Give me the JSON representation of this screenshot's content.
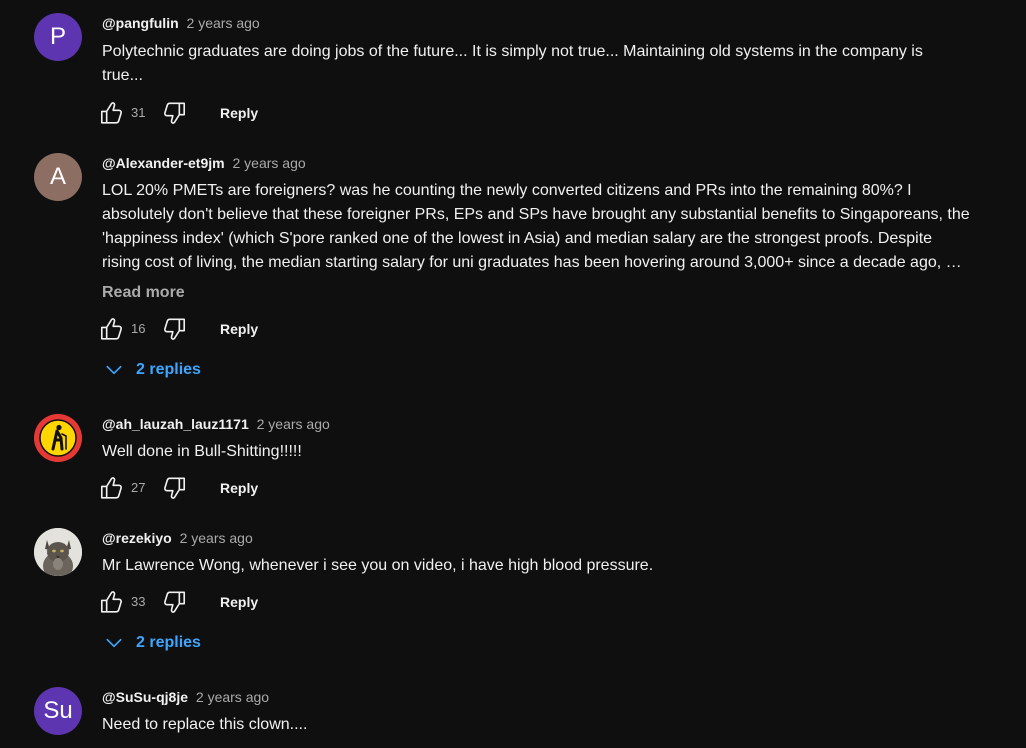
{
  "comments": [
    {
      "author": "@pangfulin",
      "time": "2 years ago",
      "avatar_letter": "P",
      "avatar_color": "#5e35b1",
      "text_lines": [
        "Polytechnic graduates are doing jobs of the future... It is simply not true... Maintaining old systems in the company is",
        "true..."
      ],
      "likes": "31",
      "reply_label": "Reply"
    },
    {
      "author": "@Alexander-et9jm",
      "time": "2 years ago",
      "avatar_letter": "A",
      "avatar_color": "#8d6e63",
      "text_lines": [
        "LOL 20% PMETs are foreigners? was he counting the newly converted citizens and PRs into the remaining 80%? I",
        "absolutely don't believe that these foreigner PRs, EPs and SPs have brought any substantial benefits to Singaporeans, the",
        "'happiness index' (which S'pore ranked one of the lowest in Asia) and median salary are the strongest proofs. Despite",
        "rising cost of living, the median starting salary for uni graduates has been hovering around 3,000+ since a decade ago, …"
      ],
      "read_more": "Read more",
      "likes": "16",
      "reply_label": "Reply",
      "replies_label": "2 replies"
    },
    {
      "author": "@ah_lauzah_lauz1171",
      "time": "2 years ago",
      "avatar_icon": "elderly-person-warning-sign-icon",
      "text_lines": [
        "Well done in Bull-Shitting!!!!!"
      ],
      "likes": "27",
      "reply_label": "Reply"
    },
    {
      "author": "@rezekiyo",
      "time": "2 years ago",
      "avatar_icon": "cat-photo-icon",
      "text_lines": [
        "Mr Lawrence Wong, whenever i see you on video, i have high blood pressure."
      ],
      "likes": "33",
      "reply_label": "Reply",
      "replies_label": "2 replies"
    },
    {
      "author": "@SuSu-qj8je",
      "time": "2 years ago",
      "avatar_letter": "Su",
      "avatar_color": "#5e35b1",
      "text_lines": [
        "Need to replace this clown...."
      ]
    }
  ]
}
